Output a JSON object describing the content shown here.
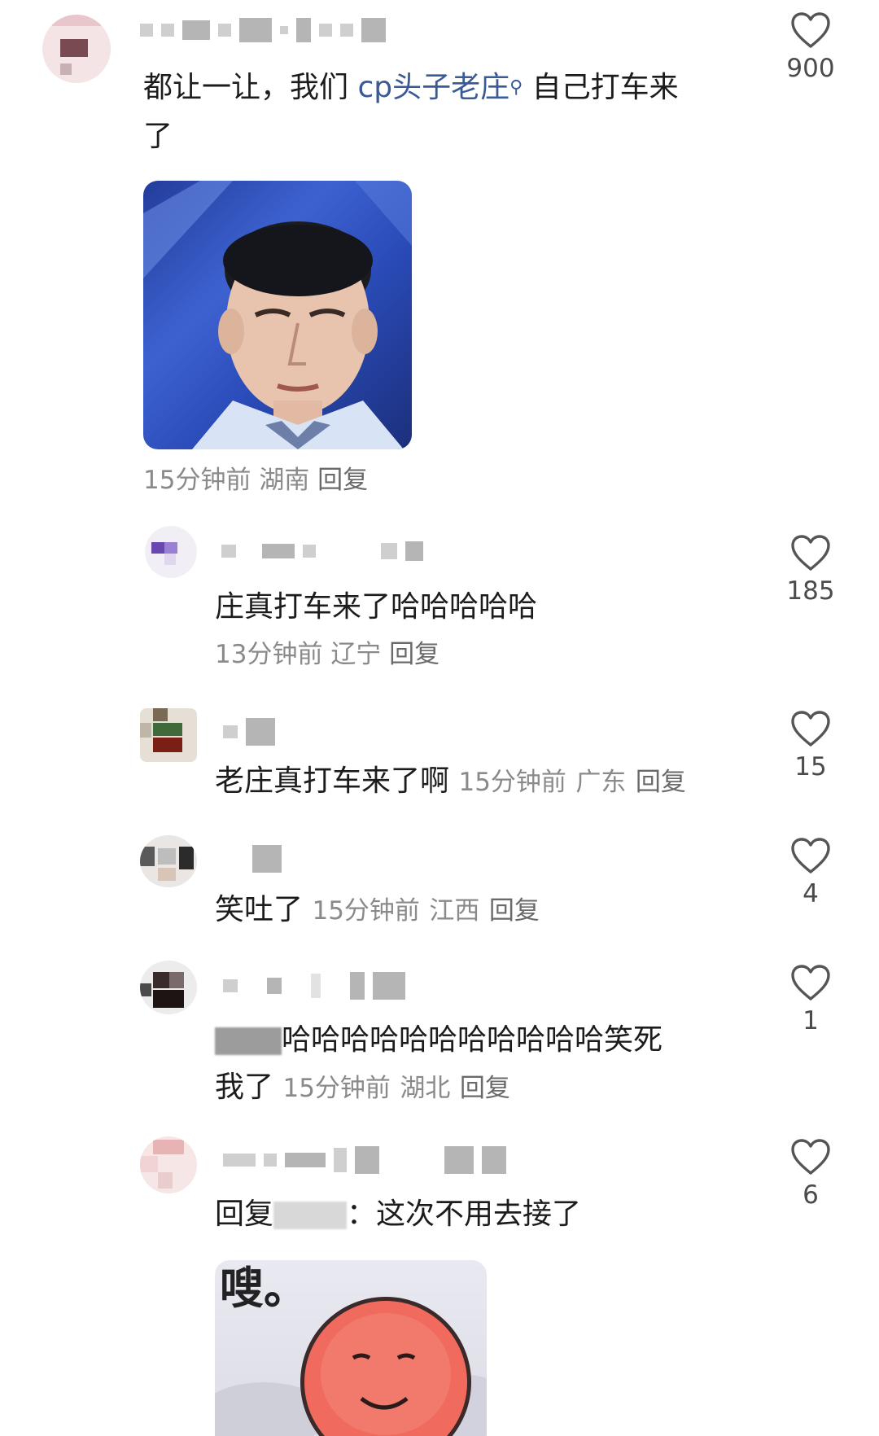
{
  "comments": [
    {
      "text_prefix": "都让一让，我们 ",
      "link_text": "cp头子老庄",
      "text_suffix": " 自己打车来",
      "text_line2": "了",
      "time": "15分钟前",
      "location": "湖南",
      "reply_label": "回复",
      "likes": "900",
      "sticker_icon": "man-portrait-sticker"
    },
    {
      "text": "庄真打车来了哈哈哈哈哈",
      "time": "13分钟前",
      "location": "辽宁",
      "reply_label": "回复",
      "likes": "185"
    },
    {
      "text": "老庄真打车来了啊",
      "time": "15分钟前",
      "location": "广东",
      "reply_label": "回复",
      "likes": "15"
    },
    {
      "text": "笑吐了",
      "time": "15分钟前",
      "location": "江西",
      "reply_label": "回复",
      "likes": "4"
    },
    {
      "text": "哈哈哈哈哈哈哈哈哈哈哈笑死",
      "text_line2": "我了",
      "time": "15分钟前",
      "location": "湖北",
      "reply_label": "回复",
      "likes": "1"
    },
    {
      "text_prefix": "回复",
      "text": "：这次不用去接了",
      "likes": "6",
      "sticker_caption": "嗖。",
      "sticker_icon": "red-face-sticker"
    }
  ],
  "colors": {
    "link": "#3a5a96",
    "meta": "#8a8a8a",
    "text": "#1c1c1c"
  }
}
